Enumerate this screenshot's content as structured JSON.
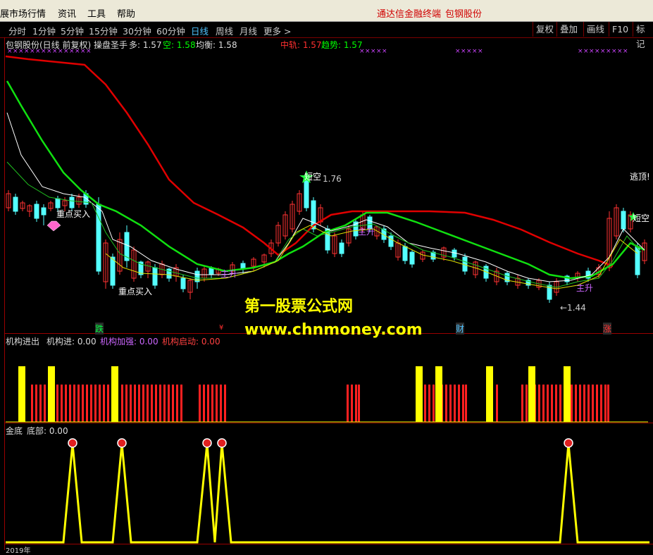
{
  "menu": {
    "items": [
      "展市场行情",
      "资讯",
      "工具",
      "帮助"
    ],
    "promo_1": "通达信金融终端",
    "promo_2": "包钢股份"
  },
  "toolbar": {
    "periods": [
      "分时",
      "1分钟",
      "5分钟",
      "15分钟",
      "30分钟",
      "60分钟",
      "日线",
      "周线",
      "月线",
      "更多 >"
    ],
    "active_period": "日线",
    "right_buttons": [
      "复权",
      "叠加",
      "画线",
      "F10",
      "标记"
    ]
  },
  "main_panel": {
    "title": "包钢股份(日线 前复权) 操盘圣手",
    "duo_label": "多: 1.57",
    "kong_label": "空: 1.58",
    "junheng_label": "均衡: 1.58",
    "zhonggui_label": "中轨: 1.57",
    "qushi_label": "趋势: 1.57",
    "annotations": {
      "zhongdian_1": "重点买入",
      "zhongdian_2": "重点买入",
      "duankong_1": "短空",
      "duankong_2": "短空",
      "taopao": "逃顶!",
      "zhusheng_1": "主升",
      "zhusheng_2": "主升",
      "zhusheng_3": "主升",
      "high_value": "1.76",
      "low_value": "←1.44",
      "die": "跌",
      "cai": "财",
      "zhang": "涨",
      "cai_s": "¥"
    }
  },
  "watermark": {
    "line1": "第一股票公式网",
    "line2": "www.chnmoney.com"
  },
  "panel2": {
    "title": "机构进出",
    "jg_jin": "机构进: 0.00",
    "jg_jiaqiang": "机构加强: 0.00",
    "jg_qidong": "机构启动: 0.00"
  },
  "panel3": {
    "title": "金底",
    "dibu": "底部: 0.00"
  },
  "date_axis": {
    "year_label": "2019年"
  },
  "colors": {
    "bg": "#000000",
    "up": "#ff3232",
    "down": "#54ffff",
    "red_line": "#e00000",
    "green_line": "#00e000",
    "yellow": "#ffff00"
  }
}
